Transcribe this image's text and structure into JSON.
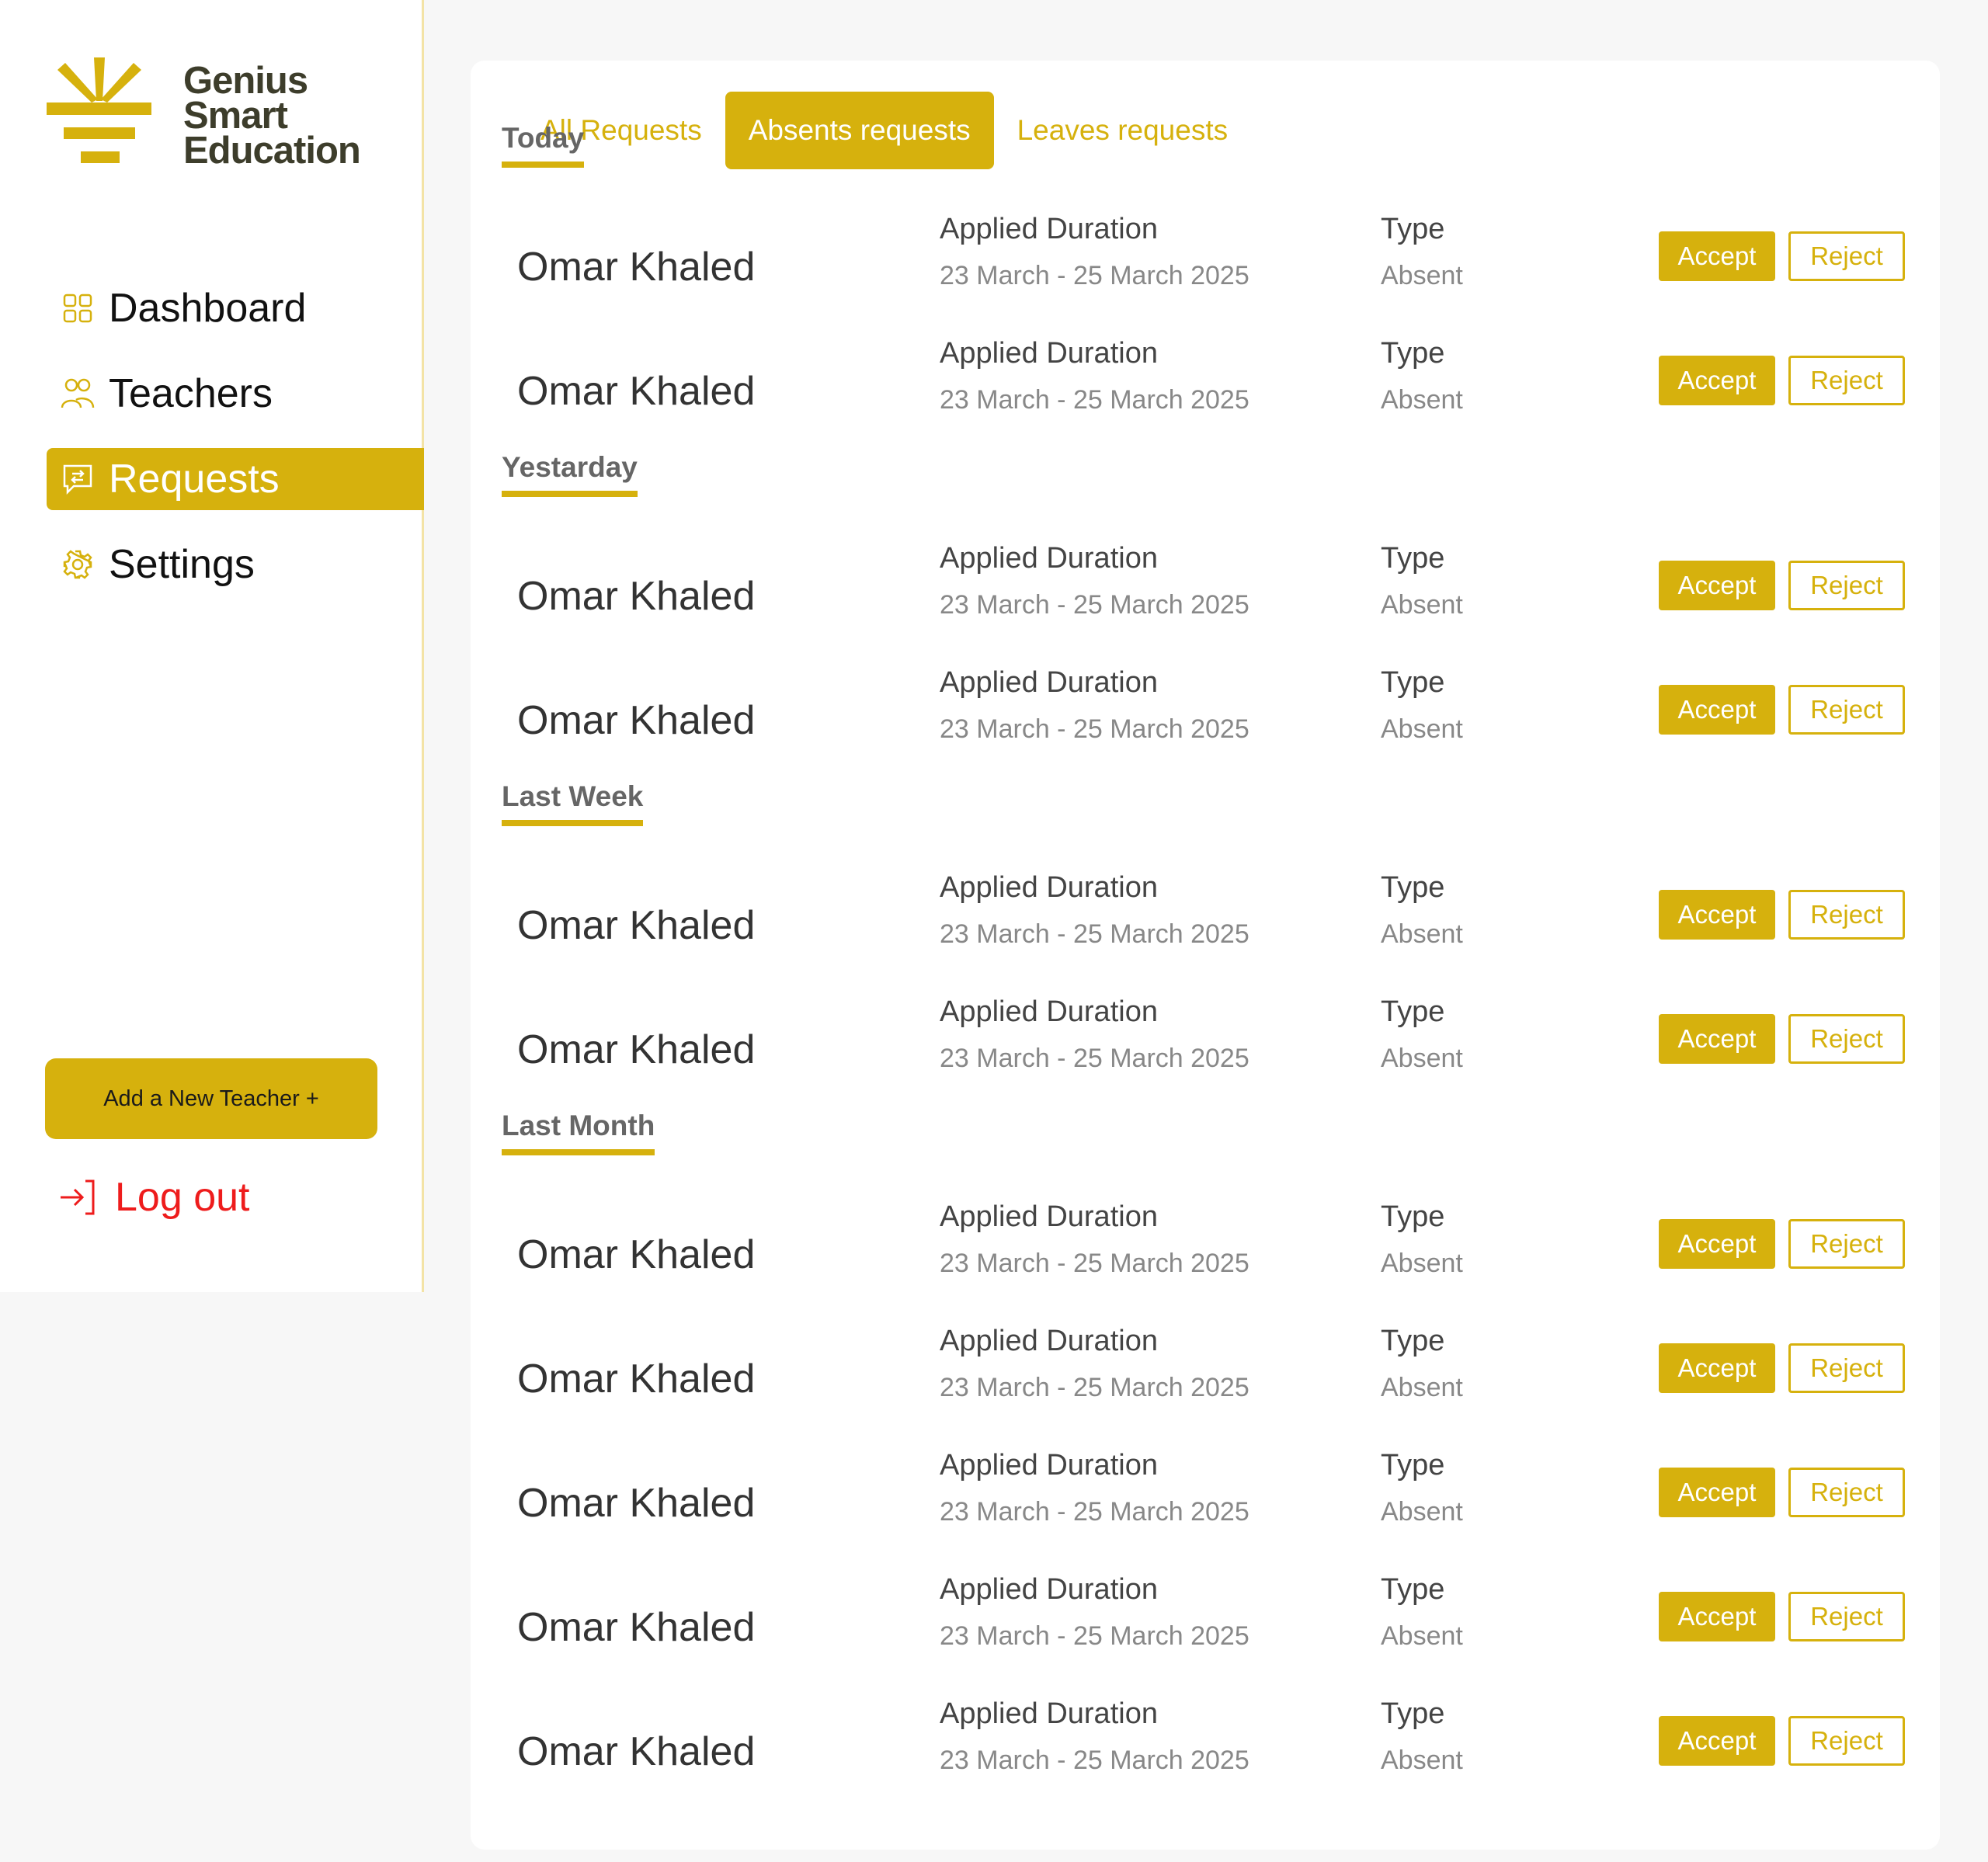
{
  "brand": {
    "line1": "Genius",
    "line2": "Smart",
    "line3": "Education",
    "color": "#d6b10d"
  },
  "sidebar": {
    "items": [
      {
        "label": "Dashboard",
        "icon": "grid-icon",
        "active": false
      },
      {
        "label": "Teachers",
        "icon": "users-icon",
        "active": false
      },
      {
        "label": "Requests",
        "icon": "chat-icon",
        "active": true
      },
      {
        "label": "Settings",
        "icon": "gear-icon",
        "active": false
      }
    ],
    "add_button": "Add a New Teacher +",
    "logout": "Log out"
  },
  "tabs": [
    {
      "label": "All Requests",
      "active": false
    },
    {
      "label": "Absents requests",
      "active": true
    },
    {
      "label": "Leaves requests",
      "active": false
    }
  ],
  "sections": [
    {
      "title": "Today",
      "rows": [
        {
          "name": "Omar Khaled",
          "duration_label": "Applied Duration",
          "duration": "23 March - 25 March 2025",
          "type_label": "Type",
          "type": "Absent",
          "accept": "Accept",
          "reject": "Reject"
        },
        {
          "name": "Omar Khaled",
          "duration_label": "Applied Duration",
          "duration": "23 March - 25 March 2025",
          "type_label": "Type",
          "type": "Absent",
          "accept": "Accept",
          "reject": "Reject"
        }
      ]
    },
    {
      "title": "Yestarday",
      "rows": [
        {
          "name": "Omar Khaled",
          "duration_label": "Applied Duration",
          "duration": "23 March - 25 March 2025",
          "type_label": "Type",
          "type": "Absent",
          "accept": "Accept",
          "reject": "Reject"
        },
        {
          "name": "Omar Khaled",
          "duration_label": "Applied Duration",
          "duration": "23 March - 25 March 2025",
          "type_label": "Type",
          "type": "Absent",
          "accept": "Accept",
          "reject": "Reject"
        }
      ]
    },
    {
      "title": "Last Week",
      "rows": [
        {
          "name": "Omar Khaled",
          "duration_label": "Applied Duration",
          "duration": "23 March - 25 March 2025",
          "type_label": "Type",
          "type": "Absent",
          "accept": "Accept",
          "reject": "Reject"
        },
        {
          "name": "Omar Khaled",
          "duration_label": "Applied Duration",
          "duration": "23 March - 25 March 2025",
          "type_label": "Type",
          "type": "Absent",
          "accept": "Accept",
          "reject": "Reject"
        }
      ]
    },
    {
      "title": "Last Month",
      "rows": [
        {
          "name": "Omar Khaled",
          "duration_label": "Applied Duration",
          "duration": "23 March - 25 March 2025",
          "type_label": "Type",
          "type": "Absent",
          "accept": "Accept",
          "reject": "Reject"
        },
        {
          "name": "Omar Khaled",
          "duration_label": "Applied Duration",
          "duration": "23 March - 25 March 2025",
          "type_label": "Type",
          "type": "Absent",
          "accept": "Accept",
          "reject": "Reject"
        },
        {
          "name": "Omar Khaled",
          "duration_label": "Applied Duration",
          "duration": "23 March - 25 March 2025",
          "type_label": "Type",
          "type": "Absent",
          "accept": "Accept",
          "reject": "Reject"
        },
        {
          "name": "Omar Khaled",
          "duration_label": "Applied Duration",
          "duration": "23 March - 25 March 2025",
          "type_label": "Type",
          "type": "Absent",
          "accept": "Accept",
          "reject": "Reject"
        },
        {
          "name": "Omar Khaled",
          "duration_label": "Applied Duration",
          "duration": "23 March - 25 March 2025",
          "type_label": "Type",
          "type": "Absent",
          "accept": "Accept",
          "reject": "Reject"
        }
      ]
    }
  ]
}
